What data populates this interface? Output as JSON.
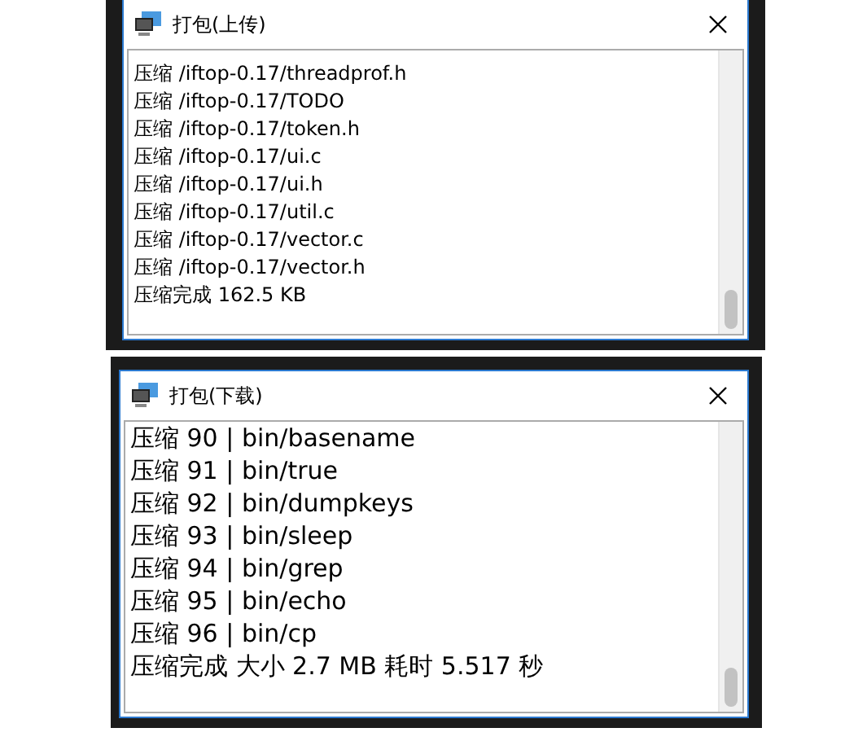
{
  "windows": [
    {
      "title": "打包(上传)",
      "kind": "compact",
      "lines": [
        "压缩 /iftop-0.17/threadprof.h",
        "压缩 /iftop-0.17/TODO",
        "压缩 /iftop-0.17/token.h",
        "压缩 /iftop-0.17/ui.c",
        "压缩 /iftop-0.17/ui.h",
        "压缩 /iftop-0.17/util.c",
        "压缩 /iftop-0.17/vector.c",
        "压缩 /iftop-0.17/vector.h",
        "压缩完成 162.5 KB"
      ]
    },
    {
      "title": "打包(下载)",
      "kind": "roomy",
      "lines": [
        "压缩 90 | bin/basename",
        "压缩 91 | bin/true",
        "压缩 92 | bin/dumpkeys",
        "压缩 93 | bin/sleep",
        "压缩 94 | bin/grep",
        "压缩 95 | bin/echo",
        "压缩 96 | bin/cp",
        "压缩完成 大小 2.7 MB 耗时 5.517 秒"
      ]
    }
  ]
}
